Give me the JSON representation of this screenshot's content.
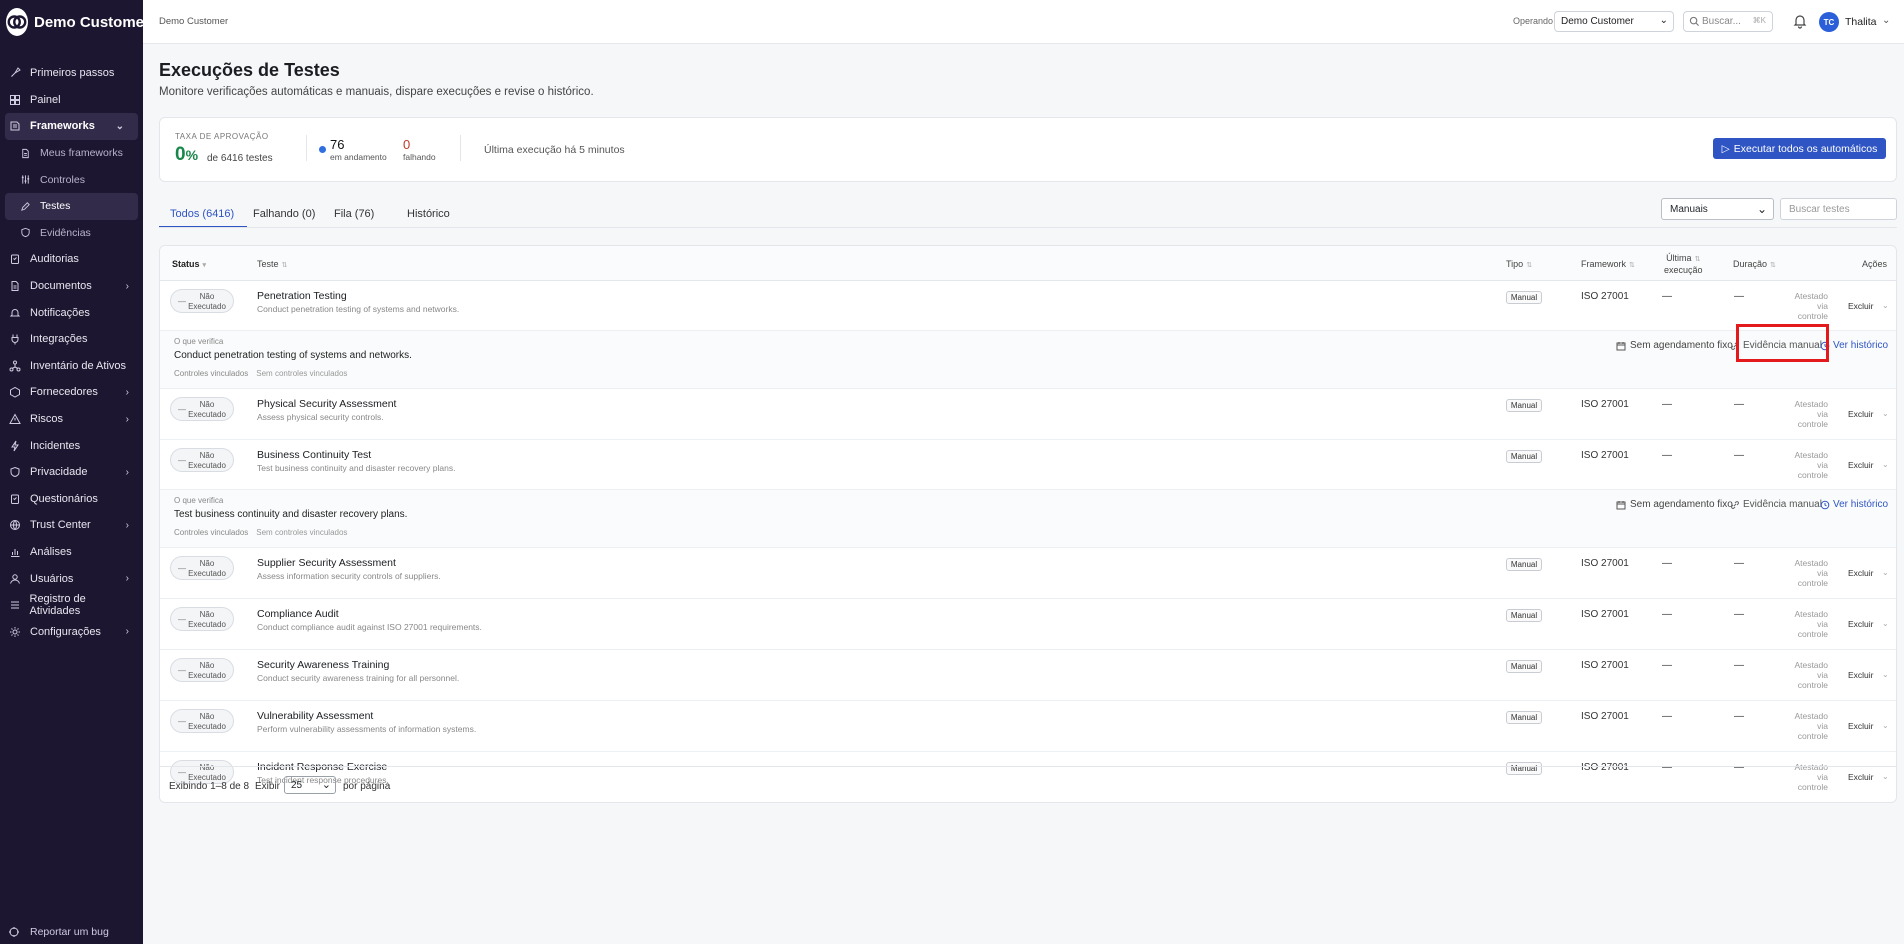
{
  "brand": {
    "name": "Demo Customer"
  },
  "sidebar": {
    "items": [
      {
        "label": "Primeiros passos",
        "icon": "rocket-icon"
      },
      {
        "label": "Painel",
        "icon": "dashboard-icon"
      },
      {
        "label": "Frameworks",
        "icon": "book-icon",
        "expanded": true
      },
      {
        "label": "Meus frameworks",
        "icon": "doc-icon",
        "sub": true
      },
      {
        "label": "Controles",
        "icon": "sliders-icon",
        "sub": true
      },
      {
        "label": "Testes",
        "icon": "pencil-icon",
        "sub": true,
        "active": true
      },
      {
        "label": "Evidências",
        "icon": "shield-icon",
        "sub": true
      },
      {
        "label": "Auditorias",
        "icon": "clipboard-icon"
      },
      {
        "label": "Documentos",
        "icon": "doc-icon",
        "chevron": true
      },
      {
        "label": "Notificações",
        "icon": "bell-icon"
      },
      {
        "label": "Integrações",
        "icon": "plug-icon"
      },
      {
        "label": "Inventário de Ativos",
        "icon": "network-icon"
      },
      {
        "label": "Fornecedores",
        "icon": "box-icon",
        "chevron": true
      },
      {
        "label": "Riscos",
        "icon": "warning-icon",
        "chevron": true
      },
      {
        "label": "Incidentes",
        "icon": "bolt-icon"
      },
      {
        "label": "Privacidade",
        "icon": "shield-icon",
        "chevron": true
      },
      {
        "label": "Questionários",
        "icon": "clipboard-icon"
      },
      {
        "label": "Trust Center",
        "icon": "globe-icon",
        "chevron": true
      },
      {
        "label": "Análises",
        "icon": "chart-icon"
      },
      {
        "label": "Usuários",
        "icon": "user-icon",
        "chevron": true
      },
      {
        "label": "Registro de Atividades",
        "icon": "list-icon"
      },
      {
        "label": "Configurações",
        "icon": "gear-icon",
        "chevron": true
      }
    ],
    "report_bug": "Reportar um bug"
  },
  "topbar": {
    "breadcrumb": "Demo Customer",
    "operating_label": "Operando",
    "operating_value": "Demo Customer",
    "search_placeholder": "Buscar...",
    "search_shortcut": "⌘K",
    "user_initials": "TC",
    "user_name": "Thalita"
  },
  "page": {
    "title": "Execuções de Testes",
    "subtitle": "Monitore verificações automáticas e manuais, dispare execuções e revise o histórico."
  },
  "stats": {
    "rate_label": "TAXA DE APROVAÇÃO",
    "rate_value": "0",
    "rate_pct": "%",
    "rate_of": "de 6416 testes",
    "running_value": "76",
    "running_label": "em andamento",
    "failing_value": "0",
    "failing_label": "falhando",
    "last_run": "Última execução há 5 minutos",
    "run_all_label": "Executar todos os automáticos"
  },
  "tabs": [
    {
      "label": "Todos (6416)",
      "active": true
    },
    {
      "label": "Falhando (0)"
    },
    {
      "label": "Fila (76)"
    },
    {
      "label": "Histórico"
    }
  ],
  "filter": {
    "value": "Manuais",
    "search_placeholder": "Buscar testes"
  },
  "table": {
    "headers": {
      "status": "Status",
      "test": "Teste",
      "type": "Tipo",
      "framework": "Framework",
      "last_run_1": "Última",
      "last_run_2": "execução",
      "duration": "Duração",
      "actions": "Ações"
    },
    "status_line1": "Não",
    "status_line2": "Executado",
    "type_value": "Manual",
    "framework_value": "ISO 27001",
    "empty": "—",
    "attest_1": "Atestado",
    "attest_2": "via",
    "attest_3": "controle",
    "delete": "Excluir",
    "rows": [
      {
        "name": "Penetration Testing",
        "desc": "Conduct penetration testing of systems and networks."
      },
      {
        "name": "Physical Security Assessment",
        "desc": "Assess physical security controls."
      },
      {
        "name": "Business Continuity Test",
        "desc": "Test business continuity and disaster recovery plans."
      },
      {
        "name": "Supplier Security Assessment",
        "desc": "Assess information security controls of suppliers."
      },
      {
        "name": "Compliance Audit",
        "desc": "Conduct compliance audit against ISO 27001 requirements."
      },
      {
        "name": "Security Awareness Training",
        "desc": "Conduct security awareness training for all personnel."
      },
      {
        "name": "Vulnerability Assessment",
        "desc": "Perform vulnerability assessments of information systems."
      },
      {
        "name": "Incident Response Exercise",
        "desc": "Test incident response procedures."
      }
    ],
    "details": [
      {
        "text": "Conduct penetration testing of systems and networks."
      },
      {
        "text": "Test business continuity and disaster recovery plans."
      }
    ],
    "detail_label": "O que verifica",
    "detail_controls": "Controles vinculados",
    "detail_no_controls": "Sem controles vinculados",
    "detail_schedule": "Sem agendamento fixo",
    "detail_evidence": "Evidência manual",
    "detail_history": "Ver histórico"
  },
  "footer": {
    "showing": "Exibindo 1–8 de 8",
    "show": "Exibir",
    "per_page_value": "25",
    "per_page": "por página"
  },
  "colors": {
    "sidebar": "#1d1631",
    "accent": "#2f55c4",
    "success": "#17874a",
    "danger": "#c0392b",
    "highlight": "#e3191b"
  }
}
